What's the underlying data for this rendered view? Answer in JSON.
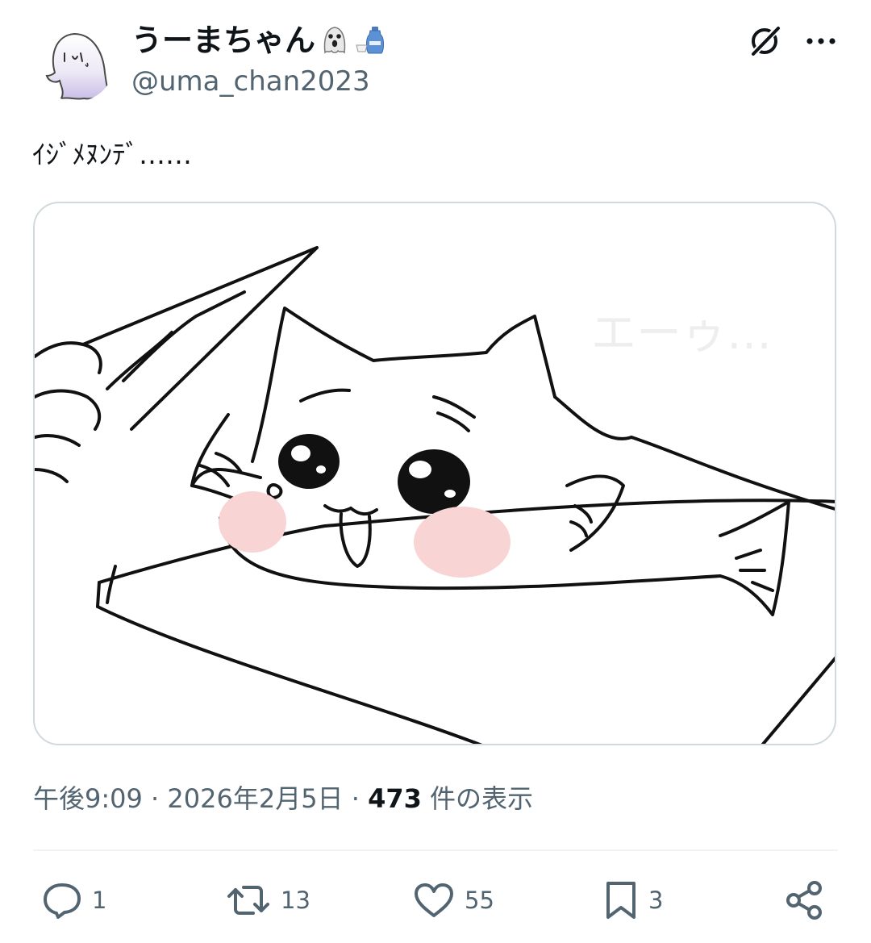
{
  "tweet": {
    "author": {
      "display_name": "うーまちゃん",
      "handle": "@uma_chan2023",
      "name_emojis": [
        "ghost-emoji",
        "sake-emoji"
      ]
    },
    "text": "ｲｼﾞﾒﾇﾝﾃﾞ……",
    "image": {
      "faint_text": "エーゥ…",
      "description_icon": "fish-cat-drawing"
    },
    "meta": {
      "time": "午後9:09",
      "separator": "·",
      "date": "2026年2月5日",
      "views_count": "473",
      "views_label": "件の表示"
    },
    "actions": {
      "reply_count": "1",
      "retweet_count": "13",
      "like_count": "55",
      "bookmark_count": "3"
    }
  },
  "icons": [
    "grok-icon",
    "more-icon",
    "reply-icon",
    "retweet-icon",
    "like-icon",
    "bookmark-icon",
    "share-icon"
  ],
  "colors": {
    "text_primary": "#0f1419",
    "text_secondary": "#536471",
    "border": "#cfd9de",
    "cheek_blush": "#f8d4d4"
  }
}
